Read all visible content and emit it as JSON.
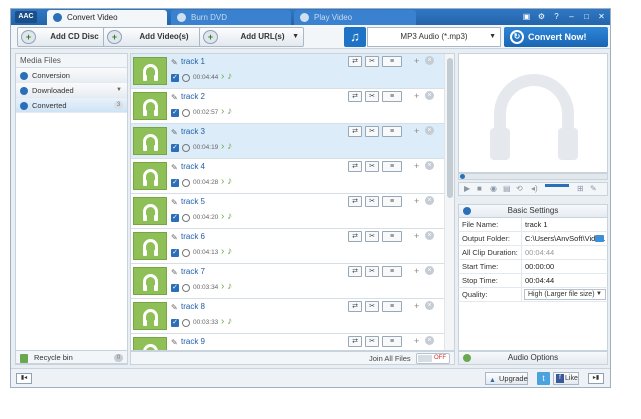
{
  "app": {
    "logo": "AAC"
  },
  "tabs": [
    {
      "label": "Convert Video",
      "active": true
    },
    {
      "label": "Burn DVD",
      "active": false
    },
    {
      "label": "Play Video",
      "active": false
    }
  ],
  "window_controls": [
    "▣",
    "⚙",
    "?",
    "–",
    "□",
    "✕"
  ],
  "toolbar": {
    "add_cd": "Add CD Disc",
    "add_videos": "Add Video(s)",
    "add_urls": "Add URL(s)",
    "format": "MP3 Audio (*.mp3)",
    "convert": "Convert Now!"
  },
  "sidebar": {
    "title": "Media Files",
    "items": [
      {
        "label": "Conversion"
      },
      {
        "label": "Downloaded"
      },
      {
        "label": "Converted",
        "count": "3"
      }
    ],
    "recycle": {
      "label": "Recycle bin",
      "count": "0"
    }
  },
  "tracks": [
    {
      "name": "track 1",
      "duration": "00:04:44"
    },
    {
      "name": "track 2",
      "duration": "00:02:57"
    },
    {
      "name": "track 3",
      "duration": "00:04:19"
    },
    {
      "name": "track 4",
      "duration": "00:04:28"
    },
    {
      "name": "track 5",
      "duration": "00:04:20"
    },
    {
      "name": "track 6",
      "duration": "00:04:13"
    },
    {
      "name": "track 7",
      "duration": "00:03:34"
    },
    {
      "name": "track 8",
      "duration": "00:03:33"
    },
    {
      "name": "track 9",
      "duration": ""
    }
  ],
  "list_footer": {
    "join_label": "Join All Files",
    "toggle_state": "OFF"
  },
  "basic_settings": {
    "title": "Basic Settings",
    "file_name_label": "File Name:",
    "file_name": "track 1",
    "output_folder_label": "Output Folder:",
    "output_folder": "C:\\Users\\AnvSoft\\Vide...",
    "all_clip_label": "All Clip Duration:",
    "all_clip": "00:04:44",
    "start_label": "Start Time:",
    "start": "00:00:00",
    "stop_label": "Stop Time:",
    "stop": "00:04:44",
    "quality_label": "Quality:",
    "quality": "High (Larger file size)"
  },
  "audio_options": "Audio Options",
  "statusbar": {
    "upgrade": "Upgrade",
    "like": "Like"
  }
}
